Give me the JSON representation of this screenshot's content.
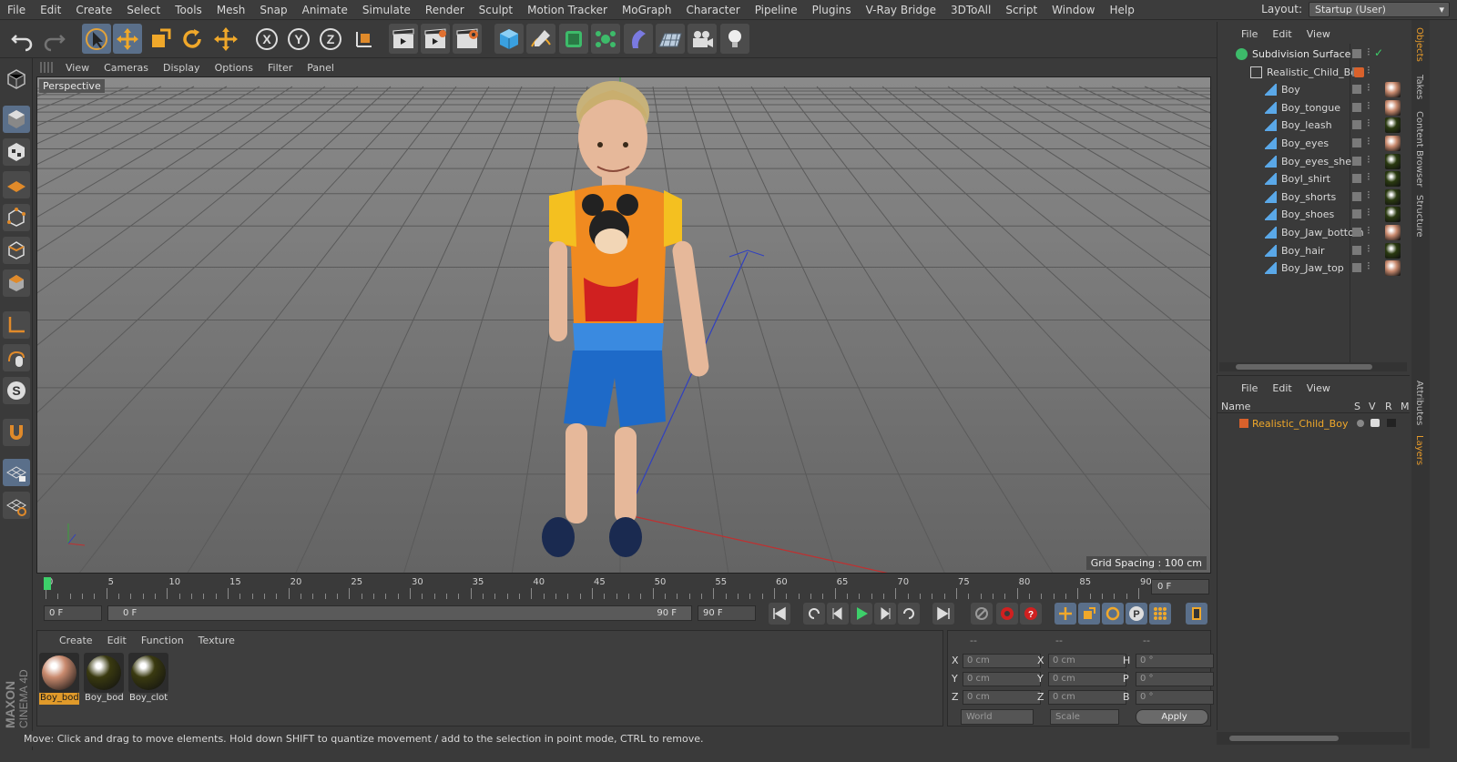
{
  "menubar": {
    "items": [
      "File",
      "Edit",
      "Create",
      "Select",
      "Tools",
      "Mesh",
      "Snap",
      "Animate",
      "Simulate",
      "Render",
      "Sculpt",
      "Motion Tracker",
      "MoGraph",
      "Character",
      "Pipeline",
      "Plugins",
      "V-Ray Bridge",
      "3DToAll",
      "Script",
      "Window",
      "Help"
    ],
    "layout_label": "Layout:",
    "layout_value": "Startup (User)"
  },
  "viewport": {
    "menu": [
      "View",
      "Cameras",
      "Display",
      "Options",
      "Filter",
      "Panel"
    ],
    "camera_label": "Perspective",
    "grid_spacing": "Grid Spacing : 100 cm"
  },
  "timeline": {
    "ticks": [
      "0",
      "5",
      "10",
      "15",
      "20",
      "25",
      "30",
      "35",
      "40",
      "45",
      "50",
      "55",
      "60",
      "65",
      "70",
      "75",
      "80",
      "85",
      "90"
    ],
    "current_frame": "0 F"
  },
  "transport": {
    "start_field": "0 F",
    "range_start": "0 F",
    "range_end": "90 F",
    "end_field": "90 F"
  },
  "materials": {
    "menu": [
      "Create",
      "Edit",
      "Function",
      "Texture"
    ],
    "items": [
      {
        "label": "Boy_bod",
        "color": "#c98a6e"
      },
      {
        "label": "Boy_bod",
        "color": "#3a3a10"
      },
      {
        "label": "Boy_clot",
        "color": "#3a3a10"
      }
    ]
  },
  "coords": {
    "headers": [
      "--",
      "--",
      "--"
    ],
    "rows": [
      {
        "a": "X",
        "av": "0 cm",
        "b": "X",
        "bv": "0 cm",
        "c": "H",
        "cv": "0 °"
      },
      {
        "a": "Y",
        "av": "0 cm",
        "b": "Y",
        "bv": "0 cm",
        "c": "P",
        "cv": "0 °"
      },
      {
        "a": "Z",
        "av": "0 cm",
        "b": "Z",
        "bv": "0 cm",
        "c": "B",
        "cv": "0 °"
      }
    ],
    "world": "World",
    "scale": "Scale",
    "apply": "Apply"
  },
  "status": {
    "text": "Move: Click and drag to move elements. Hold down SHIFT to quantize movement / add to the selection in point mode, CTRL to remove."
  },
  "brand": {
    "line1": "MAXON",
    "line2": "CINEMA 4D"
  },
  "objects": {
    "menu": [
      "File",
      "Edit",
      "View"
    ],
    "rows": [
      {
        "name": "Subdivision Surface",
        "depth": 0,
        "kind": "subdiv",
        "tag": ""
      },
      {
        "name": "Realistic_Child_Boy",
        "depth": 1,
        "kind": "null",
        "tag": "#d9612b"
      },
      {
        "name": "Boy",
        "depth": 2,
        "kind": "poly",
        "tag": "#c98a6e"
      },
      {
        "name": "Boy_tongue",
        "depth": 2,
        "kind": "poly",
        "tag": "#c98a6e"
      },
      {
        "name": "Boy_leash",
        "depth": 2,
        "kind": "poly",
        "tag": "#2a3a10"
      },
      {
        "name": "Boy_eyes",
        "depth": 2,
        "kind": "poly",
        "tag": "#c98a6e"
      },
      {
        "name": "Boy_eyes_shell",
        "depth": 2,
        "kind": "poly",
        "tag": "#2a3a10"
      },
      {
        "name": "Boyl_shirt",
        "depth": 2,
        "kind": "poly",
        "tag": "#2a3a10"
      },
      {
        "name": "Boy_shorts",
        "depth": 2,
        "kind": "poly",
        "tag": "#2a3a10"
      },
      {
        "name": "Boy_shoes",
        "depth": 2,
        "kind": "poly",
        "tag": "#2a3a10"
      },
      {
        "name": "Boy_Jaw_bottom",
        "depth": 2,
        "kind": "poly",
        "tag": "#c98a6e"
      },
      {
        "name": "Boy_hair",
        "depth": 2,
        "kind": "poly",
        "tag": "#2a3a10"
      },
      {
        "name": "Boy_Jaw_top",
        "depth": 2,
        "kind": "poly",
        "tag": "#c98a6e"
      }
    ]
  },
  "layers": {
    "menu": [
      "File",
      "Edit",
      "View"
    ],
    "head": {
      "name": "Name",
      "s": "S",
      "v": "V",
      "r": "R",
      "m": "M"
    },
    "rows": [
      {
        "name": "Realistic_Child_Boy",
        "color": "#d9612b"
      }
    ]
  },
  "sidetabs": [
    {
      "label": "Objects",
      "active": true
    },
    {
      "label": "Takes",
      "active": false
    },
    {
      "label": "Content Browser",
      "active": false
    },
    {
      "label": "Structure",
      "active": false
    },
    {
      "label": "Attributes",
      "active": false
    },
    {
      "label": "Layers",
      "active": true
    }
  ]
}
